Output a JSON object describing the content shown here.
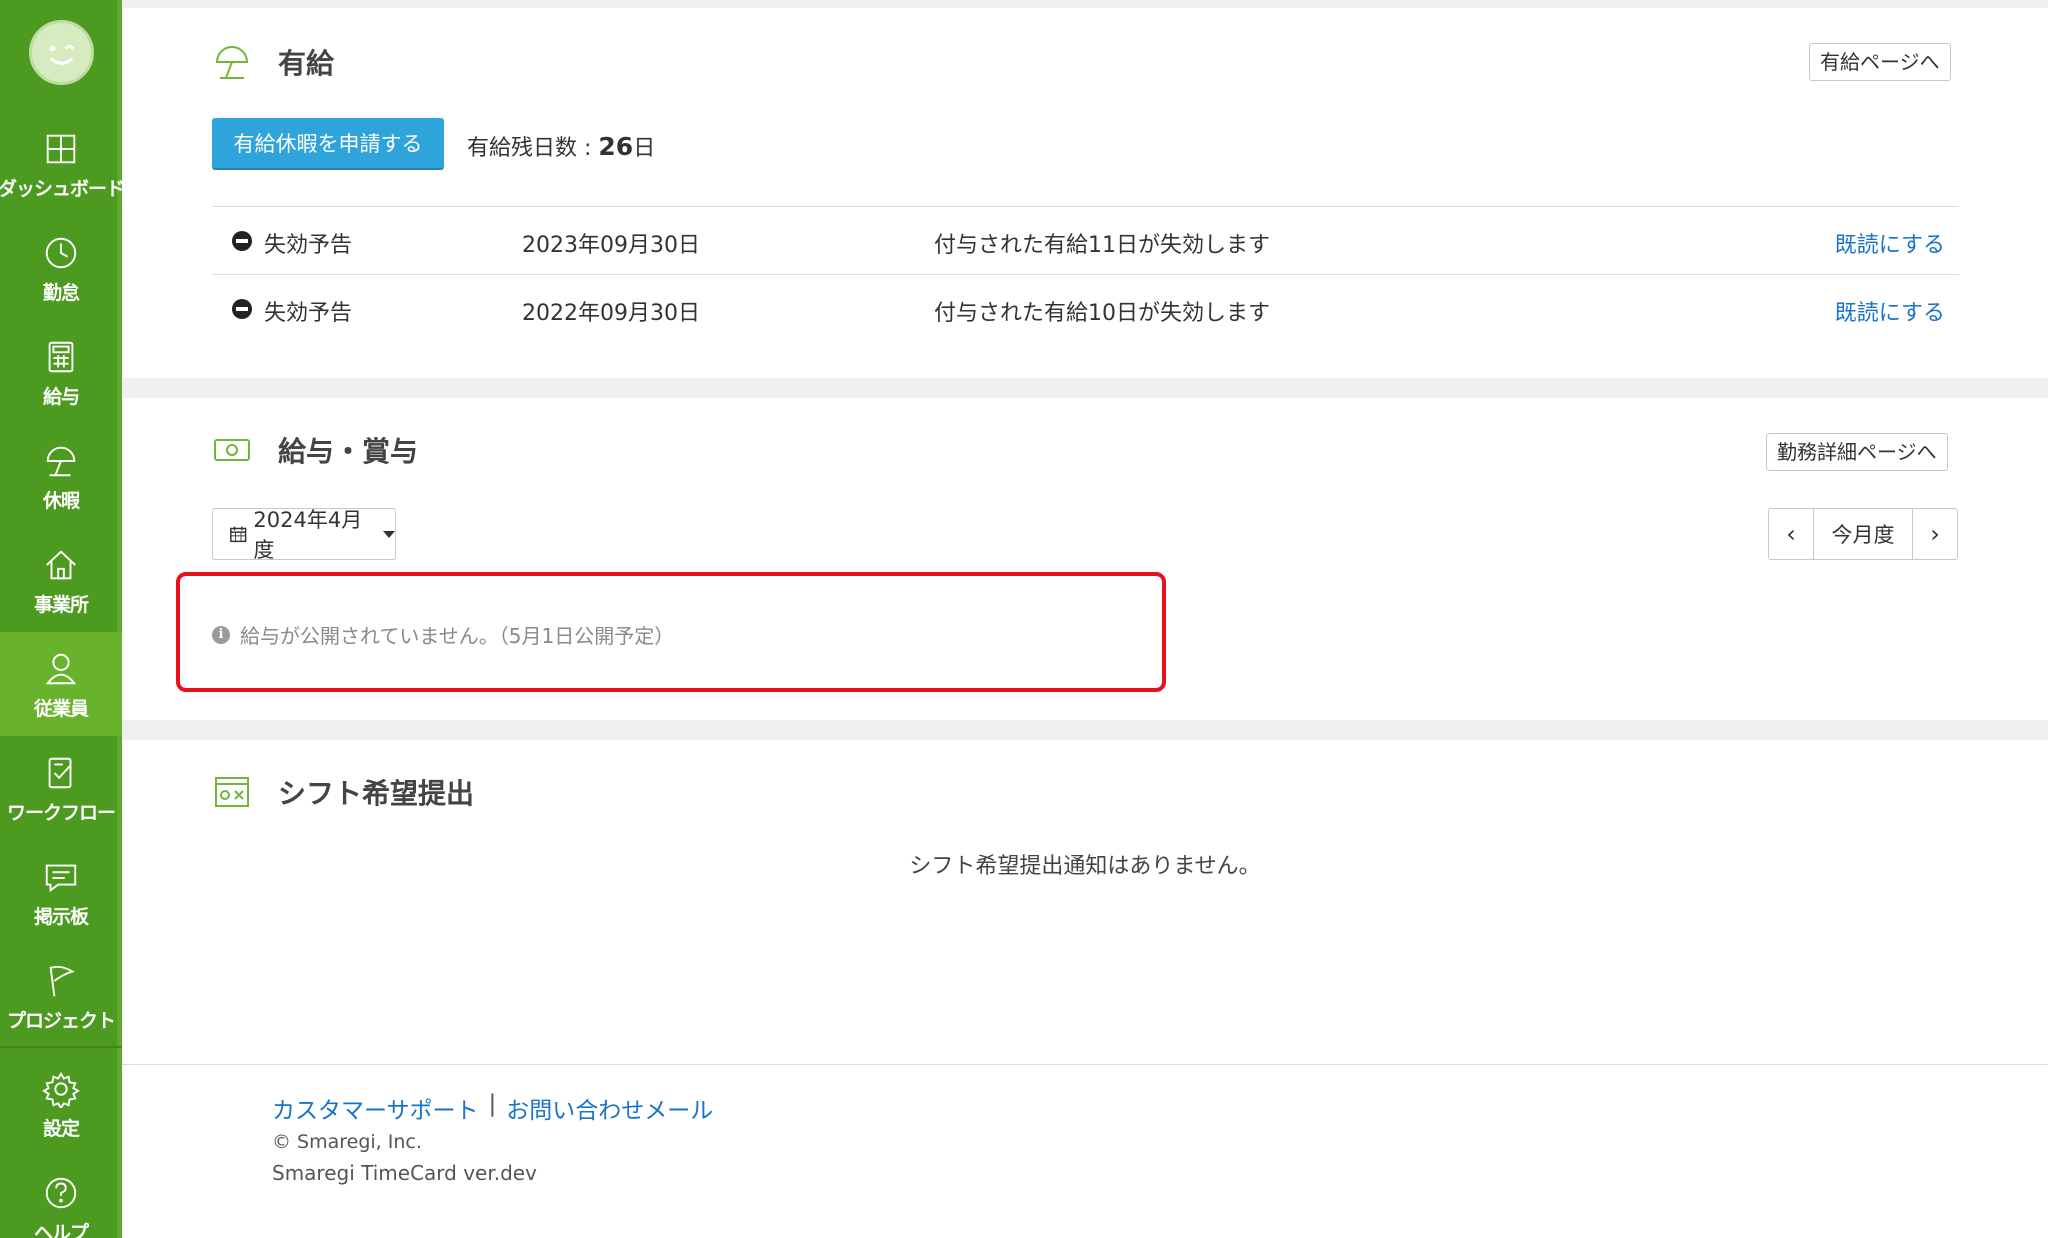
{
  "sidebar": {
    "items": [
      {
        "label": "ダッシュボード",
        "icon": "dashboard-icon"
      },
      {
        "label": "勤怠",
        "icon": "clock-icon"
      },
      {
        "label": "給与",
        "icon": "calculator-icon"
      },
      {
        "label": "休暇",
        "icon": "umbrella-icon"
      },
      {
        "label": "事業所",
        "icon": "home-icon"
      },
      {
        "label": "従業員",
        "icon": "user-icon"
      },
      {
        "label": "ワークフロー",
        "icon": "checklist-icon"
      },
      {
        "label": "掲示板",
        "icon": "message-icon"
      },
      {
        "label": "プロジェクト",
        "icon": "flag-icon"
      },
      {
        "label": "設定",
        "icon": "gear-icon"
      },
      {
        "label": "ヘルプ",
        "icon": "help-icon"
      }
    ],
    "active_item": "従業員"
  },
  "leave": {
    "title": "有給",
    "page_button": "有給ページへ",
    "apply_button": "有給休暇を申請する",
    "remaining_label": "有給残日数 : ",
    "remaining_value": "26",
    "remaining_unit": "日",
    "notices": [
      {
        "type": "失効予告",
        "date": "2023年09月30日",
        "message": "付与された有給11日が失効します",
        "action": "既読にする"
      },
      {
        "type": "失効予告",
        "date": "2022年09月30日",
        "message": "付与された有給10日が失効します",
        "action": "既読にする"
      }
    ]
  },
  "salary": {
    "title": "給与・賞与",
    "page_button": "勤務詳細ページへ",
    "month_select": "2024年4月度",
    "pager": {
      "prev": "‹",
      "current": "今月度",
      "next": "›"
    },
    "notice": "給与が公開されていません。（5月1日公開予定）"
  },
  "shift": {
    "title": "シフト希望提出",
    "empty": "シフト希望提出通知はありません。"
  },
  "footer": {
    "support_link": "カスタマーサポート",
    "separator": "|",
    "contact_link": "お問い合わせメール",
    "copyright": "© Smaregi, Inc.",
    "version": "Smaregi TimeCard ver.dev"
  },
  "colors": {
    "sidebar": "#4c9a1f",
    "sidebar_active": "#69b32c",
    "primary_button": "#2ea4db",
    "link": "#1a73c8",
    "highlight": "#e8101a"
  }
}
